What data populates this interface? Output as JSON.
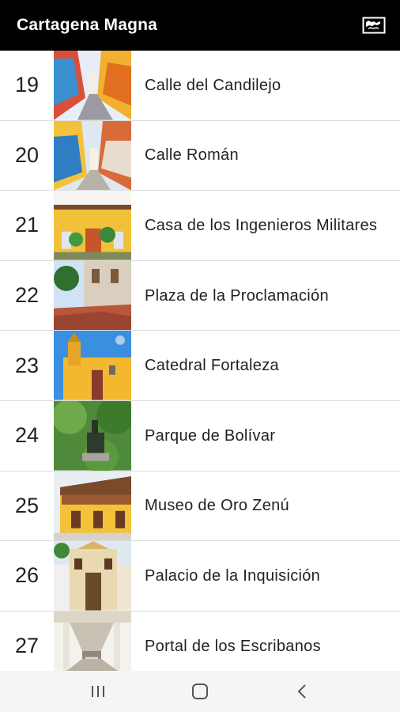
{
  "app_bar": {
    "title": "Cartagena Magna",
    "map_icon": "map-icon"
  },
  "items": [
    {
      "number": "19",
      "name": "Calle del Candilejo",
      "thumb_icon": "street-photo"
    },
    {
      "number": "20",
      "name": "Calle Román",
      "thumb_icon": "street-photo"
    },
    {
      "number": "21",
      "name": "Casa de los Ingenieros Militares",
      "thumb_icon": "building-photo"
    },
    {
      "number": "22",
      "name": "Plaza de la Proclamación",
      "thumb_icon": "plaza-photo"
    },
    {
      "number": "23",
      "name": "Catedral Fortaleza",
      "thumb_icon": "church-photo"
    },
    {
      "number": "24",
      "name": "Parque de Bolívar",
      "thumb_icon": "park-photo"
    },
    {
      "number": "25",
      "name": "Museo de Oro Zenú",
      "thumb_icon": "building-photo"
    },
    {
      "number": "26",
      "name": "Palacio de la Inquisición",
      "thumb_icon": "palace-photo"
    },
    {
      "number": "27",
      "name": "Portal de los Escribanos",
      "thumb_icon": "arcade-photo"
    }
  ],
  "nav_bar": {
    "recents_icon": "recents-icon",
    "home_icon": "home-icon",
    "back_icon": "back-icon"
  }
}
